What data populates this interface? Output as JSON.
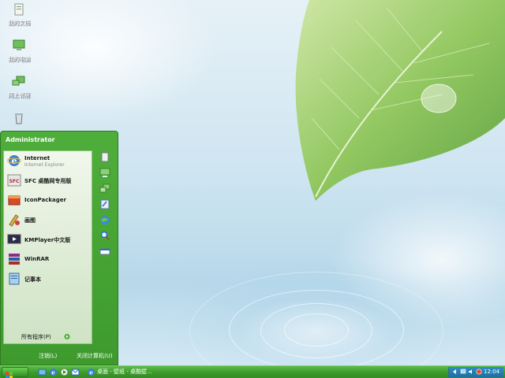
{
  "desktop": {
    "icons": [
      {
        "name": "my-documents",
        "label": "我的文档"
      },
      {
        "name": "my-computer",
        "label": "我的电脑"
      },
      {
        "name": "network-places",
        "label": "网上邻居"
      },
      {
        "name": "recycle-bin",
        "label": ""
      }
    ]
  },
  "start_menu": {
    "user": "Administrator",
    "programs": [
      {
        "name": "Internet",
        "sub": "Internet Explorer"
      },
      {
        "name": "SFC 桌酷网专用版",
        "sub": ""
      },
      {
        "name": "IconPackager",
        "sub": ""
      },
      {
        "name": "画图",
        "sub": ""
      },
      {
        "name": "KMPlayer中文版",
        "sub": ""
      },
      {
        "name": "WinRAR",
        "sub": ""
      },
      {
        "name": "记事本",
        "sub": ""
      }
    ],
    "all_programs": "所有程序(P)",
    "logoff": "注销(L)",
    "shutdown": "关闭计算机(U)"
  },
  "taskbar": {
    "task_title": "桌面 - 壁纸 - 桌酷壁...",
    "clock": "12:04"
  },
  "colors": {
    "menu_green": "#3e9a2d",
    "taskbar_green": "#3c9a2b",
    "tray_blue": "#1f6f9e",
    "panel_light": "#dcebd4"
  }
}
